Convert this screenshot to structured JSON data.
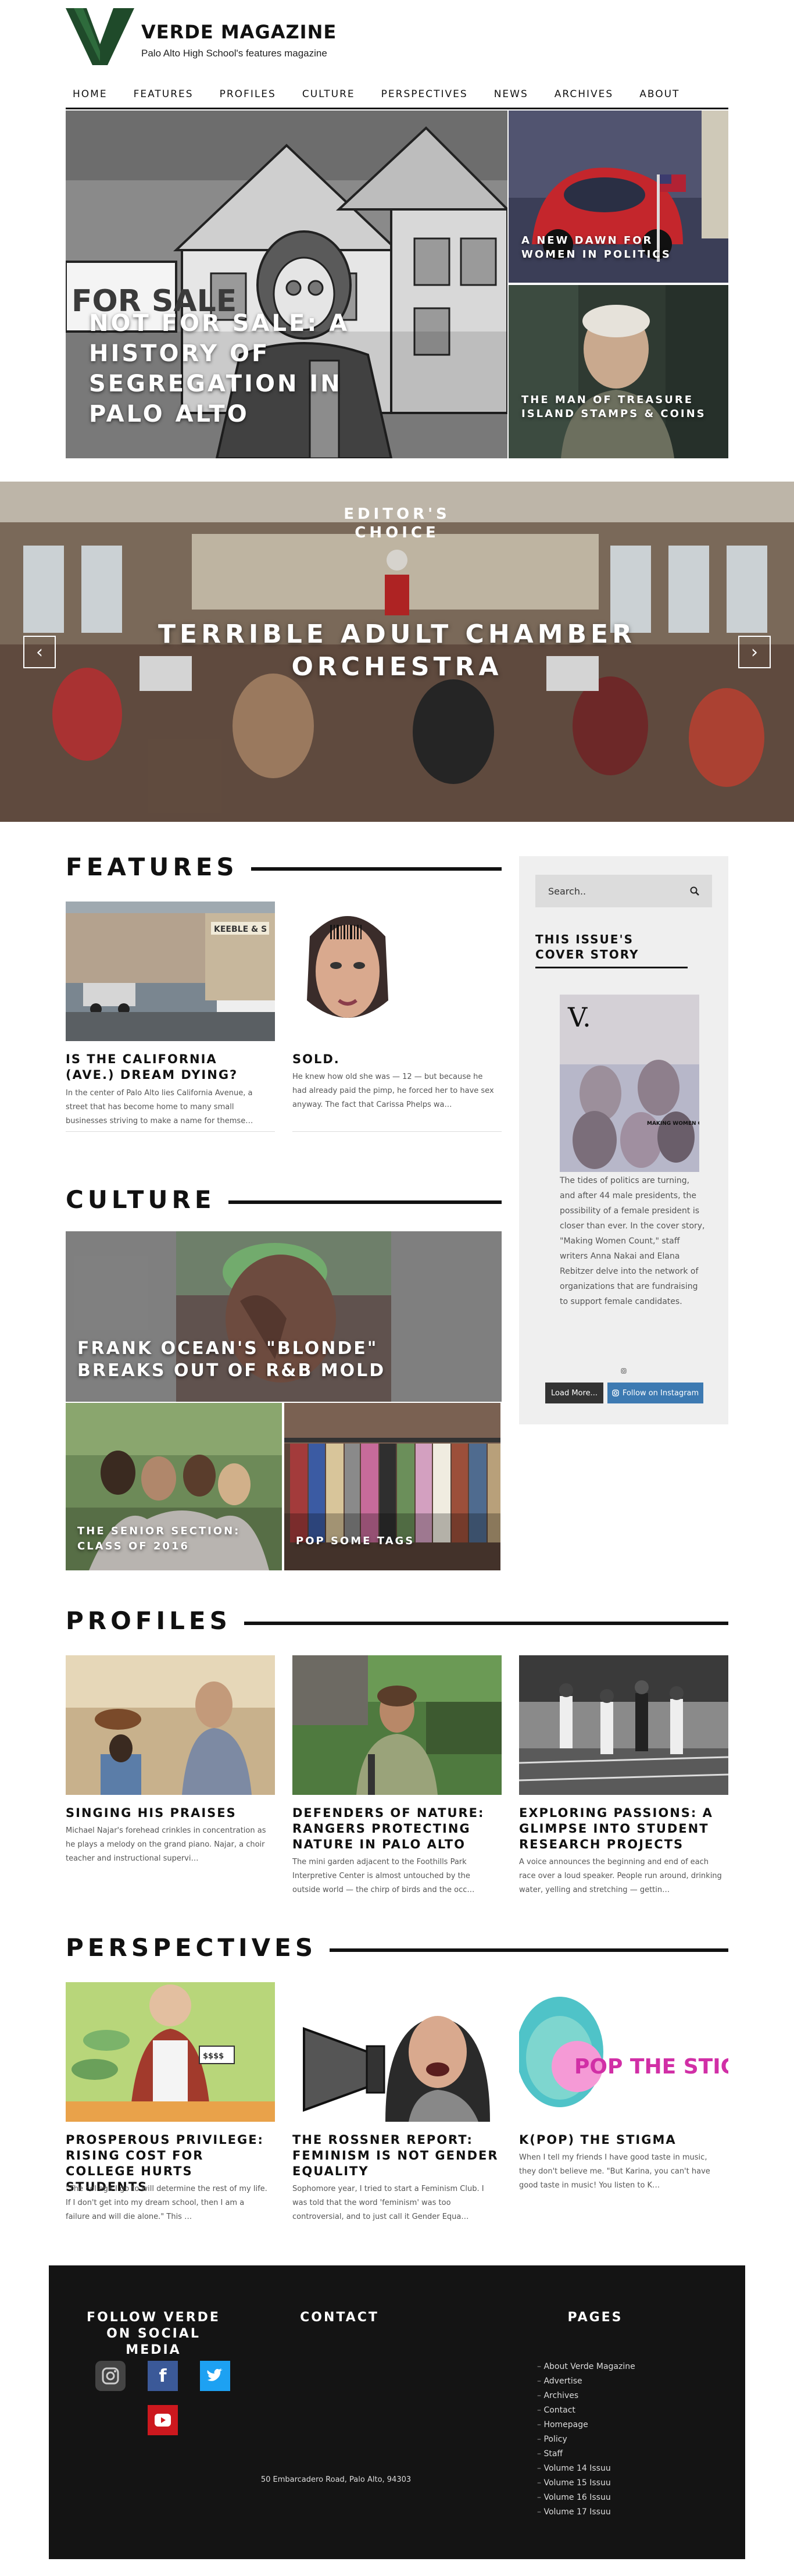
{
  "brand": {
    "title": "VERDE MAGAZINE",
    "subtitle": "Palo Alto High School's features magazine",
    "colors": {
      "logo_green": "#1f4a2a",
      "accent_blue": "#3d7ab2",
      "footer_bg": "#141414"
    }
  },
  "nav": {
    "items": [
      "HOME",
      "FEATURES",
      "PROFILES",
      "CULTURE",
      "PERSPECTIVES",
      "NEWS",
      "ARCHIVES",
      "ABOUT"
    ]
  },
  "top_stories": {
    "main": {
      "title": "NOT FOR SALE: A HISTORY OF SEGREGATION IN PALO ALTO",
      "sign_text": "FOR SALE"
    },
    "side": [
      {
        "title": "A NEW DAWN FOR WOMEN IN POLITICS"
      },
      {
        "title": "THE MAN OF TREASURE ISLAND STAMPS & COINS"
      }
    ]
  },
  "slider": {
    "label": "EDITOR'S CHOICE",
    "title": "TERRIBLE ADULT CHAMBER ORCHESTRA",
    "prev_icon": "chevron-left-icon",
    "next_icon": "chevron-right-icon",
    "prev_glyph": "‹",
    "next_glyph": "›"
  },
  "features": {
    "heading": "FEATURES",
    "items": [
      {
        "title": "IS THE CALIFORNIA (AVE.) DREAM DYING?",
        "excerpt": "In the center of Palo Alto lies California Avenue, a street that has become home to many small businesses striving to make a name for themse…",
        "sign": "KEEBLE & S"
      },
      {
        "title": "SOLD.",
        "excerpt": "He knew how old she was — 12 — but because he had already paid the pimp, he forced her to have sex anyway. The fact that Carissa Phelps wa…"
      }
    ]
  },
  "sidebar": {
    "search_placeholder": "Search..",
    "search_icon": "search-icon",
    "cover_title": "THIS ISSUE'S COVER STORY",
    "cover_masthead": "V.",
    "cover_caption": "MAKING WOMEN COUNT",
    "cover_text": "The tides of politics are turning, and after 44 male presidents, the possibility of a female president is closer than ever. In the cover story, \"Making Women Count,\" staff writers Anna Nakai and Elana Rebitzer delve into the network of organizations that are fundraising to support female candidates.",
    "load_more": "Load More...",
    "follow_instagram": "Follow on Instagram"
  },
  "culture": {
    "heading": "CULTURE",
    "main_title": "FRANK OCEAN'S \"BLONDE\" BREAKS OUT OF R&B MOLD",
    "small": [
      {
        "title": "THE SENIOR SECTION: CLASS OF 2016"
      },
      {
        "title": "POP SOME TAGS"
      }
    ]
  },
  "profiles": {
    "heading": "PROFILES",
    "items": [
      {
        "title": "SINGING HIS PRAISES",
        "excerpt": "Michael Najar's forehead crinkles in concentration as he plays a melody on the grand piano. Najar, a choir teacher and instructional supervi…"
      },
      {
        "title": "DEFENDERS OF NATURE: RANGERS PROTECTING NATURE IN PALO ALTO",
        "excerpt": "The mini garden adjacent to the Foothills Park Interpretive Center is almost untouched by the outside world — the chirp of birds and the occ…"
      },
      {
        "title": "EXPLORING PASSIONS: A GLIMPSE INTO STUDENT RESEARCH PROJECTS",
        "excerpt": "A voice announces the beginning and end of each race over a loud speaker. People run around, drinking water, yelling and stretching — gettin…"
      }
    ]
  },
  "perspectives": {
    "heading": "PERSPECTIVES",
    "items": [
      {
        "title": "PROSPEROUS PRIVILEGE: RISING COST FOR COLLEGE HURTS STUDENTS",
        "excerpt": "\"The college I go to will determine the rest of my life. If I don't get into my dream school, then I am a failure and will die alone.\" This …",
        "price_tag": "$$$$"
      },
      {
        "title": "THE ROSSNER REPORT: FEMINISM IS NOT GENDER EQUALITY",
        "excerpt": "Sophomore year, I tried to start a Feminism Club. I was told that the word 'feminism' was too controversial, and to just call it Gender Equa…"
      },
      {
        "title": "K(POP) THE STIGMA",
        "excerpt": "When I tell my friends I have good taste in music, they don't believe me. \"But Karina, you can't have good taste in music! You listen to K…",
        "banner": "POP THE STIGMA"
      }
    ]
  },
  "footer": {
    "social_title": "FOLLOW VERDE ON SOCIAL MEDIA",
    "contact_title": "CONTACT",
    "pages_title": "PAGES",
    "address": "50 Embarcadero Road, Palo Alto, 94303",
    "social": [
      {
        "icon": "instagram-icon",
        "color": "#444444"
      },
      {
        "icon": "facebook-icon",
        "color": "#3b5998",
        "glyph": "f"
      },
      {
        "icon": "twitter-icon",
        "color": "#1da1f2"
      },
      {
        "icon": "youtube-icon",
        "color": "#cc181e"
      }
    ],
    "pages": [
      "About Verde Magazine",
      "Advertise",
      "Archives",
      "Contact",
      "Homepage",
      "Policy",
      "Staff",
      "Volume 14 Issuu",
      "Volume 15 Issuu",
      "Volume 16 Issuu",
      "Volume 17 Issuu"
    ]
  }
}
